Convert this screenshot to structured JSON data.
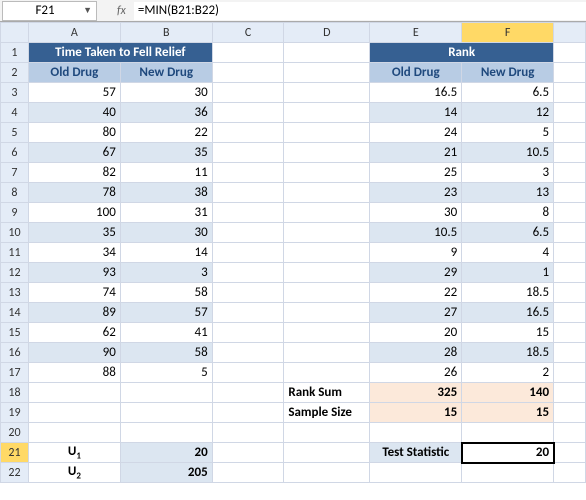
{
  "nameBox": "F21",
  "fxLabel": "fx",
  "formula": "=MIN(B21:B22)",
  "colHeaders": [
    "A",
    "B",
    "C",
    "D",
    "E",
    "F"
  ],
  "rowHeaders": [
    1,
    2,
    3,
    4,
    5,
    6,
    7,
    8,
    9,
    10,
    11,
    12,
    13,
    14,
    15,
    16,
    17,
    18,
    19,
    20,
    21,
    22
  ],
  "headers": {
    "timeTitle": "Time Taken to Fell Relief",
    "rankTitle": "Rank",
    "oldDrug": "Old Drug",
    "newDrug": "New Drug"
  },
  "rows": [
    {
      "a": "57",
      "b": "30",
      "e": "16.5",
      "f": "6.5"
    },
    {
      "a": "40",
      "b": "36",
      "e": "14",
      "f": "12"
    },
    {
      "a": "80",
      "b": "22",
      "e": "24",
      "f": "5"
    },
    {
      "a": "67",
      "b": "35",
      "e": "21",
      "f": "10.5"
    },
    {
      "a": "82",
      "b": "11",
      "e": "25",
      "f": "3"
    },
    {
      "a": "78",
      "b": "38",
      "e": "23",
      "f": "13"
    },
    {
      "a": "100",
      "b": "31",
      "e": "30",
      "f": "8"
    },
    {
      "a": "35",
      "b": "30",
      "e": "10.5",
      "f": "6.5"
    },
    {
      "a": "34",
      "b": "14",
      "e": "9",
      "f": "4"
    },
    {
      "a": "93",
      "b": "3",
      "e": "29",
      "f": "1"
    },
    {
      "a": "74",
      "b": "58",
      "e": "22",
      "f": "18.5"
    },
    {
      "a": "89",
      "b": "57",
      "e": "27",
      "f": "16.5"
    },
    {
      "a": "62",
      "b": "41",
      "e": "20",
      "f": "15"
    },
    {
      "a": "90",
      "b": "58",
      "e": "28",
      "f": "18.5"
    },
    {
      "a": "88",
      "b": "5",
      "e": "26",
      "f": "2"
    }
  ],
  "labels": {
    "rankSum": "Rank Sum",
    "sampleSize": "Sample Size",
    "testStat": "Test Statistic",
    "u1": "U",
    "u1sub": "1",
    "u2": "U",
    "u2sub": "2"
  },
  "summary": {
    "rankSumE": "325",
    "rankSumF": "140",
    "sampleE": "15",
    "sampleF": "15",
    "u1Val": "20",
    "u2Val": "205",
    "testStatVal": "20"
  },
  "chart_data": {
    "type": "table",
    "title": "Time Taken to Fell Relief / Rank",
    "series": [
      {
        "name": "Time Old Drug",
        "values": [
          57,
          40,
          80,
          67,
          82,
          78,
          100,
          35,
          34,
          93,
          74,
          89,
          62,
          90,
          88
        ]
      },
      {
        "name": "Time New Drug",
        "values": [
          30,
          36,
          22,
          35,
          11,
          38,
          31,
          30,
          14,
          3,
          58,
          57,
          41,
          58,
          5
        ]
      },
      {
        "name": "Rank Old Drug",
        "values": [
          16.5,
          14,
          24,
          21,
          25,
          23,
          30,
          10.5,
          9,
          29,
          22,
          27,
          20,
          28,
          26
        ]
      },
      {
        "name": "Rank New Drug",
        "values": [
          6.5,
          12,
          5,
          10.5,
          3,
          13,
          8,
          6.5,
          4,
          1,
          18.5,
          16.5,
          15,
          18.5,
          2
        ]
      }
    ],
    "summary": {
      "RankSum": [
        325,
        140
      ],
      "SampleSize": [
        15,
        15
      ],
      "U1": 20,
      "U2": 205,
      "TestStatistic": 20
    }
  }
}
